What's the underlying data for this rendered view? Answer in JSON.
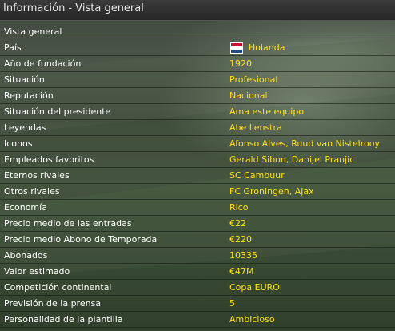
{
  "window": {
    "title": "Información - Vista general"
  },
  "section": {
    "title": "Vista general"
  },
  "rows": [
    {
      "label": "País",
      "value": "Holanda",
      "icon": "netherlands-flag-icon"
    },
    {
      "label": "Año de fundación",
      "value": "1920"
    },
    {
      "label": "Situación",
      "value": "Profesional"
    },
    {
      "label": "Reputación",
      "value": "Nacional"
    },
    {
      "label": "Situación del presidente",
      "value": "Ama este equipo"
    },
    {
      "label": "Leyendas",
      "value": "Abe Lenstra"
    },
    {
      "label": "Iconos",
      "value": "Afonso Alves, Ruud van Nistelrooy"
    },
    {
      "label": "Empleados favoritos",
      "value": "Gerald Sibon, Danijel Pranjic"
    },
    {
      "label": "Eternos rivales",
      "value": "SC Cambuur"
    },
    {
      "label": "Otros rivales",
      "value": "FC Groningen, Ajax"
    },
    {
      "label": "Economía",
      "value": "Rico"
    },
    {
      "label": "Precio medio de las entradas",
      "value": "€22"
    },
    {
      "label": "Precio medio Abono de Temporada",
      "value": "€220"
    },
    {
      "label": "Abonados",
      "value": "10335"
    },
    {
      "label": "Valor estimado",
      "value": "€47M"
    },
    {
      "label": "Competición continental",
      "value": "Copa EURO"
    },
    {
      "label": "Previsión de la prensa",
      "value": "5"
    },
    {
      "label": "Personalidad de la plantilla",
      "value": "Ambicioso"
    }
  ],
  "colors": {
    "label": "#ffffff",
    "value": "#ffe01a",
    "title_bar": "#2e2e2e"
  }
}
